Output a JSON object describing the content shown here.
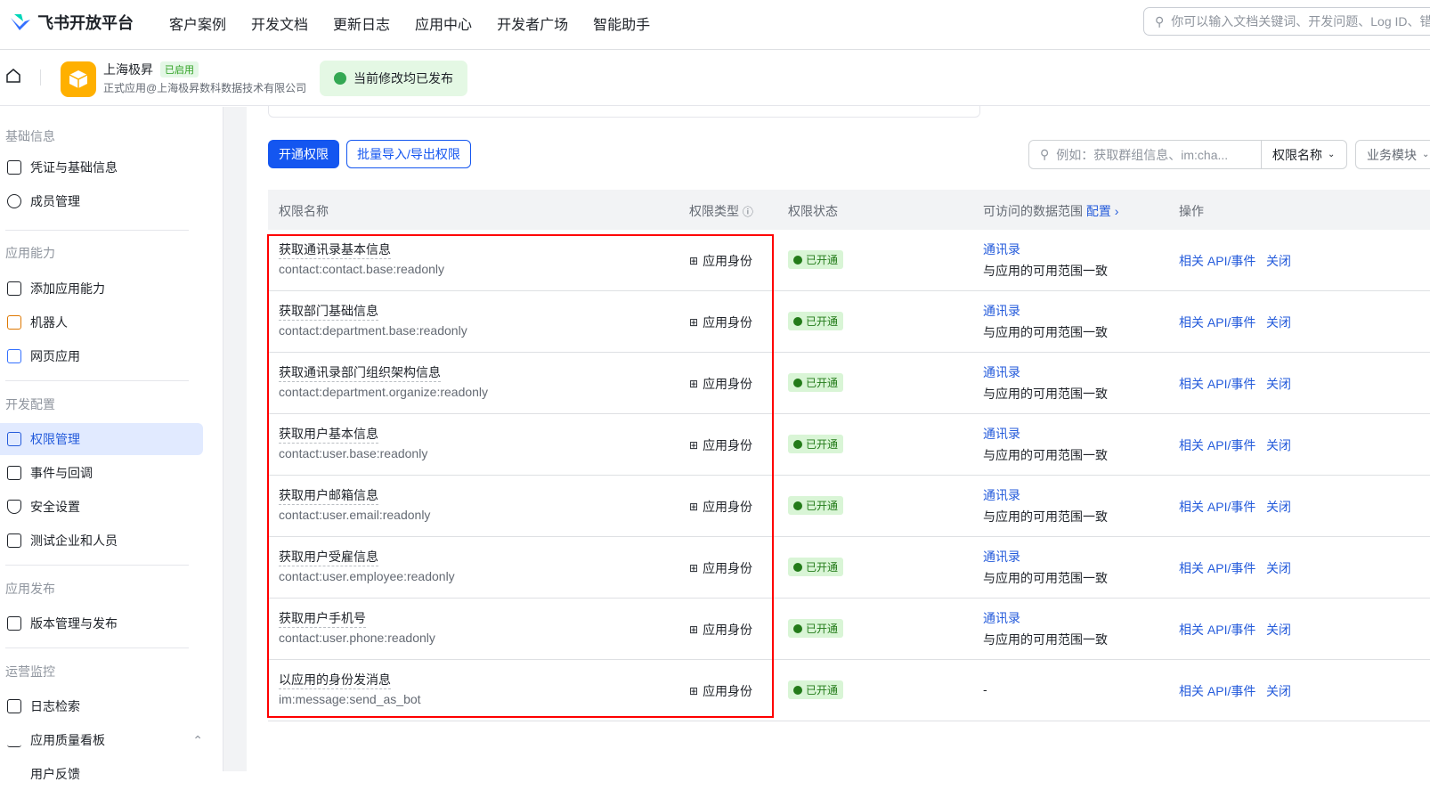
{
  "topbar": {
    "logo": "飞书开放平台",
    "nav": [
      "客户案例",
      "开发文档",
      "更新日志",
      "应用中心",
      "开发者广场",
      "智能助手"
    ],
    "search_placeholder": "你可以输入文档关键词、开发问题、Log ID、错"
  },
  "app": {
    "name": "上海极昇",
    "status": "已启用",
    "subtitle": "正式应用@上海极昇数科数据技术有限公司",
    "publish_status": "当前修改均已发布"
  },
  "sidebar": {
    "sections": [
      "基础信息",
      "应用能力",
      "开发配置",
      "应用发布",
      "运营监控"
    ],
    "items": [
      "凭证与基础信息",
      "成员管理",
      "添加应用能力",
      "机器人",
      "网页应用",
      "权限管理",
      "事件与回调",
      "安全设置",
      "测试企业和人员",
      "版本管理与发布",
      "日志检索",
      "应用质量看板",
      "用户反馈"
    ]
  },
  "toolbar": {
    "enable": "开通权限",
    "bulk": "批量导入/导出权限",
    "filter_placeholder": "例如：获取群组信息、im:cha...",
    "filter_field": "权限名称",
    "module": "业务模块"
  },
  "table": {
    "headers": {
      "name": "权限名称",
      "type": "权限类型",
      "status": "权限状态",
      "scope": "可访问的数据范围",
      "config": "配置",
      "ops": "操作"
    },
    "rows": [
      {
        "name": "获取通讯录基本信息",
        "key": "contact:contact.base:readonly",
        "type": "应用身份",
        "status": "已开通",
        "scope": "通讯录",
        "scope_desc": "与应用的可用范围一致",
        "op1": "相关 API/事件",
        "op2": "关闭"
      },
      {
        "name": "获取部门基础信息",
        "key": "contact:department.base:readonly",
        "type": "应用身份",
        "status": "已开通",
        "scope": "通讯录",
        "scope_desc": "与应用的可用范围一致",
        "op1": "相关 API/事件",
        "op2": "关闭"
      },
      {
        "name": "获取通讯录部门组织架构信息",
        "key": "contact:department.organize:readonly",
        "type": "应用身份",
        "status": "已开通",
        "scope": "通讯录",
        "scope_desc": "与应用的可用范围一致",
        "op1": "相关 API/事件",
        "op2": "关闭"
      },
      {
        "name": "获取用户基本信息",
        "key": "contact:user.base:readonly",
        "type": "应用身份",
        "status": "已开通",
        "scope": "通讯录",
        "scope_desc": "与应用的可用范围一致",
        "op1": "相关 API/事件",
        "op2": "关闭"
      },
      {
        "name": "获取用户邮箱信息",
        "key": "contact:user.email:readonly",
        "type": "应用身份",
        "status": "已开通",
        "scope": "通讯录",
        "scope_desc": "与应用的可用范围一致",
        "op1": "相关 API/事件",
        "op2": "关闭"
      },
      {
        "name": "获取用户受雇信息",
        "key": "contact:user.employee:readonly",
        "type": "应用身份",
        "status": "已开通",
        "scope": "通讯录",
        "scope_desc": "与应用的可用范围一致",
        "op1": "相关 API/事件",
        "op2": "关闭"
      },
      {
        "name": "获取用户手机号",
        "key": "contact:user.phone:readonly",
        "type": "应用身份",
        "status": "已开通",
        "scope": "通讯录",
        "scope_desc": "与应用的可用范围一致",
        "op1": "相关 API/事件",
        "op2": "关闭"
      },
      {
        "name": "以应用的身份发消息",
        "key": "im:message:send_as_bot",
        "type": "应用身份",
        "status": "已开通",
        "scope": "-",
        "scope_desc": "",
        "op1": "相关 API/事件",
        "op2": "关闭"
      }
    ]
  },
  "colors": {
    "primary": "#1456f0",
    "link": "#245bdb",
    "highlight": "#ff0000"
  }
}
